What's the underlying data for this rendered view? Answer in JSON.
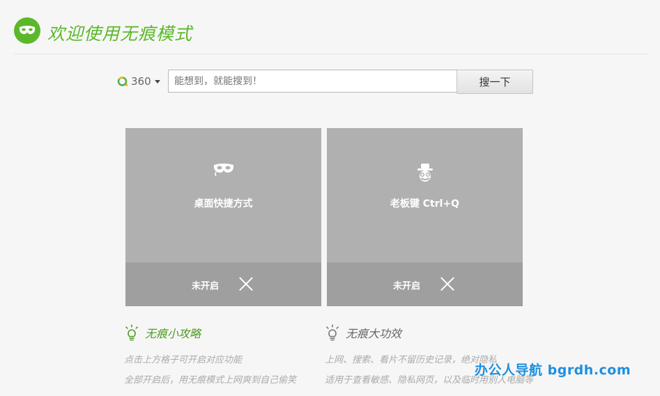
{
  "header": {
    "title": "欢迎使用无痕模式",
    "logo_icon": "mask-icon"
  },
  "search": {
    "engine": "360",
    "engine_icon": "360-search-logo-icon",
    "placeholder": "能想到，就能搜到！",
    "button_label": "搜一下"
  },
  "cards": [
    {
      "label": "桌面快捷方式",
      "icon": "mask-icon",
      "status": "未开启"
    },
    {
      "label": "老板键 Ctrl+Q",
      "icon": "disguise-icon",
      "status": "未开启"
    }
  ],
  "tips": [
    {
      "title": "无痕小攻略",
      "icon": "lightbulb-icon",
      "color": "#4f9a23",
      "lines": [
        "点击上方格子可开启对应功能",
        "全部开启后，用无痕模式上网爽到自己偷笑"
      ]
    },
    {
      "title": "无痕大功效",
      "icon": "lightbulb-icon",
      "color": "#666666",
      "lines": [
        "上网、搜索、看片不留历史记录，绝对隐私",
        "适用于查看敏感、隐私网页，以及临时用别人电脑等"
      ]
    }
  ],
  "watermark": "办公人导航  bgrdh.com",
  "colors": {
    "accent": "#5cb82a",
    "card": "#b0b0b0",
    "card_footer": "#9f9f9f"
  }
}
